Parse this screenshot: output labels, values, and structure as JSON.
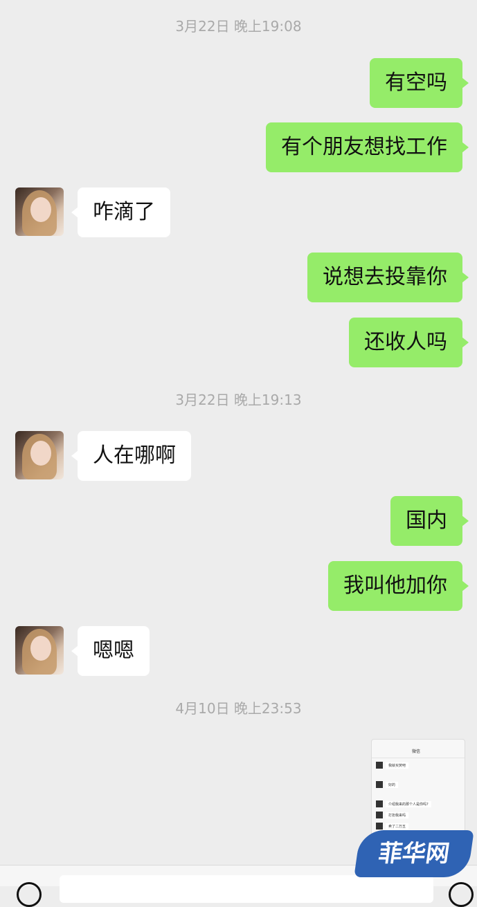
{
  "timestamps": [
    "3月22日 晚上19:08",
    "3月22日 晚上19:13",
    "4月10日 晚上23:53"
  ],
  "messages": [
    {
      "side": "me",
      "text": "有空吗"
    },
    {
      "side": "me",
      "text": "有个朋友想找工作"
    },
    {
      "side": "them",
      "text": "咋滴了"
    },
    {
      "side": "me",
      "text": "说想去投靠你"
    },
    {
      "side": "me",
      "text": "还收人吗"
    },
    {
      "side": "them",
      "text": "人在哪啊"
    },
    {
      "side": "me",
      "text": "国内"
    },
    {
      "side": "me",
      "text": "我叫他加你"
    },
    {
      "side": "them",
      "text": "嗯嗯"
    }
  ],
  "screenshot_thumb": {
    "title": "微信",
    "lines": [
      "我就买荧吧",
      "好的",
      "介绍我来的那个人是你吗?",
      "打扮我来吗",
      "卖了二万五"
    ]
  },
  "watermark": "菲华网",
  "colors": {
    "me_bubble": "#95ec69",
    "them_bubble": "#ffffff",
    "background": "#ededed",
    "watermark": "#2f63b4"
  }
}
